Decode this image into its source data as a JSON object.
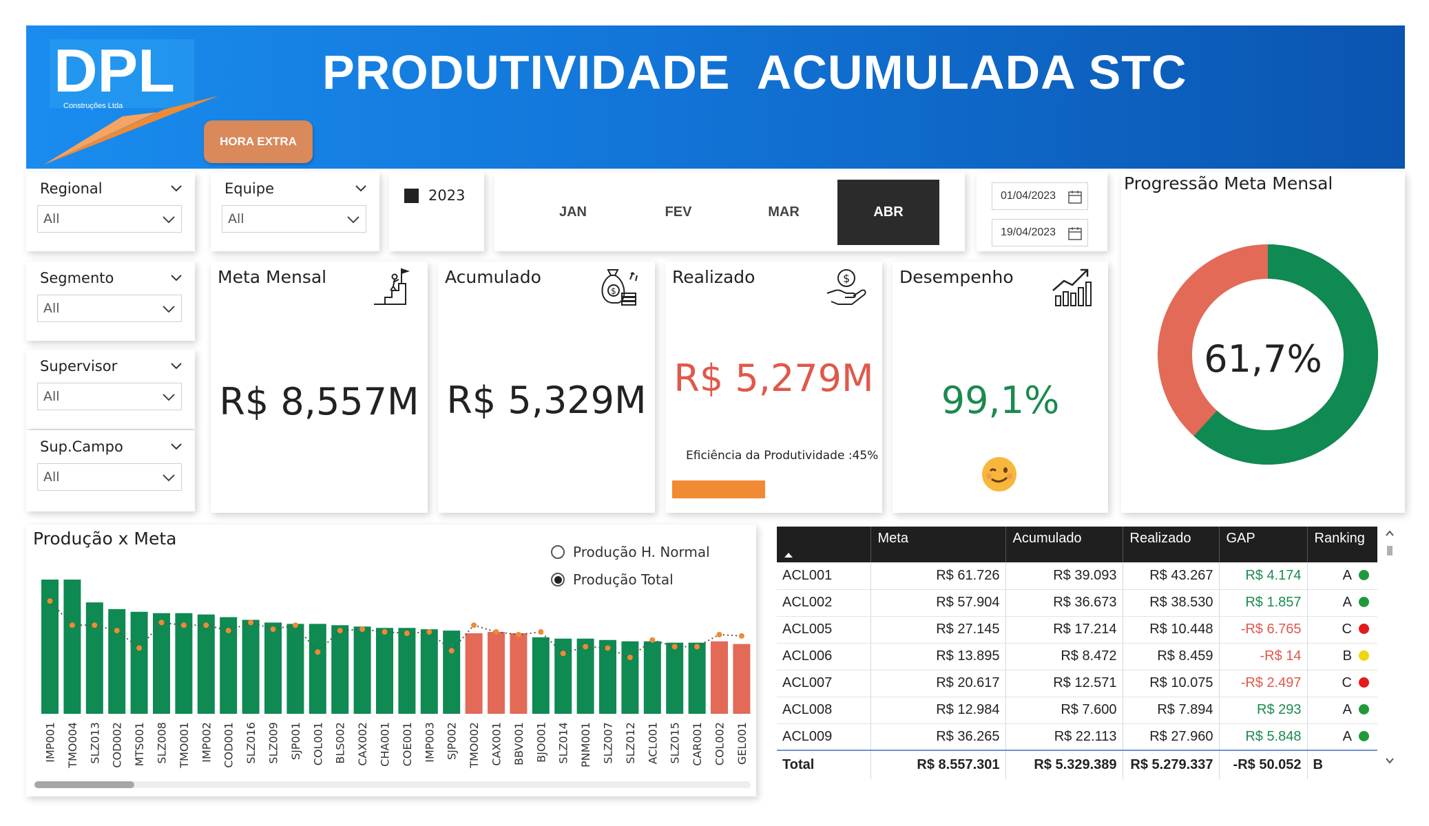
{
  "header": {
    "title": "PRODUTIVIDADE  ACUMULADA STC",
    "logo_text": "DPL",
    "logo_subtext": "Construções Ltda",
    "hora_extra_button": "HORA EXTRA",
    "colors": {
      "banner_start": "#1a8cef",
      "banner_end": "#0a55b0",
      "logo_orange": "#f08a33",
      "button_bg": "#d9895a"
    }
  },
  "filters": {
    "regional": {
      "label": "Regional",
      "value": "All"
    },
    "equipe": {
      "label": "Equipe",
      "value": "All"
    },
    "segmento": {
      "label": "Segmento",
      "value": "All"
    },
    "supervisor": {
      "label": "Supervisor",
      "value": "All"
    },
    "sup_campo": {
      "label": "Sup.Campo",
      "value": "All"
    },
    "year": {
      "label": "2023",
      "checked": true
    },
    "months": [
      {
        "label": "JAN",
        "selected": false
      },
      {
        "label": "FEV",
        "selected": false
      },
      {
        "label": "MAR",
        "selected": false
      },
      {
        "label": "ABR",
        "selected": true
      }
    ],
    "date_start": "01/04/2023",
    "date_end": "19/04/2023"
  },
  "kpis": {
    "meta_mensal": {
      "title": "Meta Mensal",
      "value": "R$ 8,557M",
      "icon": "goal-climb-icon"
    },
    "acumulado": {
      "title": "Acumulado",
      "value": "R$ 5,329M",
      "icon": "money-bag-icon"
    },
    "realizado": {
      "title": "Realizado",
      "value": "R$ 5,279M",
      "icon": "hand-coin-icon",
      "color": "#e0584a",
      "efficiency_label": "Eficiência da Produtividade :45%",
      "efficiency_fraction": 0.45
    },
    "desempenho": {
      "title": "Desempenho",
      "value": "99,1%",
      "icon": "growth-chart-icon",
      "color": "#1b8a4f",
      "emoji": "😉"
    }
  },
  "progress": {
    "title": "Progressão Meta Mensal",
    "value": "61,7%",
    "fraction": 0.617,
    "colors": {
      "achieved": "#0e8a52",
      "remaining": "#e26a57"
    }
  },
  "chart_data": {
    "type": "bar",
    "title": "Produção x Meta",
    "legend": [
      "Produção H. Normal",
      "Produção Total"
    ],
    "legend_selected": 1,
    "categories": [
      "IMP001",
      "TMO004",
      "SLZ013",
      "COD002",
      "MTS001",
      "SLZ008",
      "TMO001",
      "IMP002",
      "COD001",
      "SLZ016",
      "SLZ009",
      "SJP001",
      "COL001",
      "BLS002",
      "CAX002",
      "CHA001",
      "COE001",
      "IMP003",
      "SJP002",
      "TMO002",
      "CAX001",
      "BBV001",
      "BJO001",
      "SLZ014",
      "PNM001",
      "SLZ007",
      "SLZ012",
      "ACL001",
      "SLZ015",
      "CAR001",
      "COL002",
      "GEL001"
    ],
    "values": [
      100,
      100,
      83,
      78,
      76,
      75,
      75,
      74,
      72,
      70,
      68,
      67,
      67,
      66,
      65,
      64,
      64,
      63,
      62,
      60,
      61,
      60,
      57,
      56,
      56,
      55,
      54,
      54,
      53,
      53,
      54,
      52
    ],
    "meta": [
      84,
      66,
      66,
      62,
      49,
      68,
      66,
      66,
      62,
      68,
      63,
      66,
      46,
      62,
      63,
      61,
      60,
      61,
      47,
      66,
      61,
      59,
      61,
      45,
      50,
      49,
      42,
      55,
      50,
      50,
      59,
      58
    ],
    "bar_colors": [
      "g",
      "g",
      "g",
      "g",
      "g",
      "g",
      "g",
      "g",
      "g",
      "g",
      "g",
      "g",
      "g",
      "g",
      "g",
      "g",
      "g",
      "g",
      "g",
      "r",
      "r",
      "r",
      "g",
      "g",
      "g",
      "g",
      "g",
      "g",
      "g",
      "g",
      "r",
      "r"
    ],
    "colors": {
      "g": "#0e8a52",
      "r": "#e26a57",
      "meta_marker": "#f08a33"
    }
  },
  "table": {
    "columns": [
      "",
      "Meta",
      "Acumulado",
      "Realizado",
      "GAP",
      "Ranking"
    ],
    "rows": [
      {
        "name": "ACL001",
        "meta": "R$ 61.726",
        "acumulado": "R$ 39.093",
        "realizado": "R$ 43.267",
        "gap": "R$ 4.174",
        "gap_sign": "pos",
        "rank": "A",
        "rank_color": "#1f9a3a"
      },
      {
        "name": "ACL002",
        "meta": "R$ 57.904",
        "acumulado": "R$ 36.673",
        "realizado": "R$ 38.530",
        "gap": "R$ 1.857",
        "gap_sign": "pos",
        "rank": "A",
        "rank_color": "#1f9a3a"
      },
      {
        "name": "ACL005",
        "meta": "R$ 27.145",
        "acumulado": "R$ 17.214",
        "realizado": "R$ 10.448",
        "gap": "-R$ 6.765",
        "gap_sign": "neg",
        "rank": "C",
        "rank_color": "#e31b1b"
      },
      {
        "name": "ACL006",
        "meta": "R$ 13.895",
        "acumulado": "R$ 8.472",
        "realizado": "R$ 8.459",
        "gap": "-R$ 14",
        "gap_sign": "neg",
        "rank": "B",
        "rank_color": "#f2d40b"
      },
      {
        "name": "ACL007",
        "meta": "R$ 20.617",
        "acumulado": "R$ 12.571",
        "realizado": "R$ 10.075",
        "gap": "-R$ 2.497",
        "gap_sign": "neg",
        "rank": "C",
        "rank_color": "#e31b1b"
      },
      {
        "name": "ACL008",
        "meta": "R$ 12.984",
        "acumulado": "R$ 7.600",
        "realizado": "R$ 7.894",
        "gap": "R$ 293",
        "gap_sign": "pos",
        "rank": "A",
        "rank_color": "#1f9a3a"
      },
      {
        "name": "ACL009",
        "meta": "R$ 36.265",
        "acumulado": "R$ 22.113",
        "realizado": "R$ 27.960",
        "gap": "R$ 5.848",
        "gap_sign": "pos",
        "rank": "A",
        "rank_color": "#1f9a3a"
      }
    ],
    "total": {
      "name": "Total",
      "meta": "R$ 8.557.301",
      "acumulado": "R$ 5.329.389",
      "realizado": "R$ 5.279.337",
      "gap": "-R$ 50.052",
      "rank": "B"
    }
  }
}
